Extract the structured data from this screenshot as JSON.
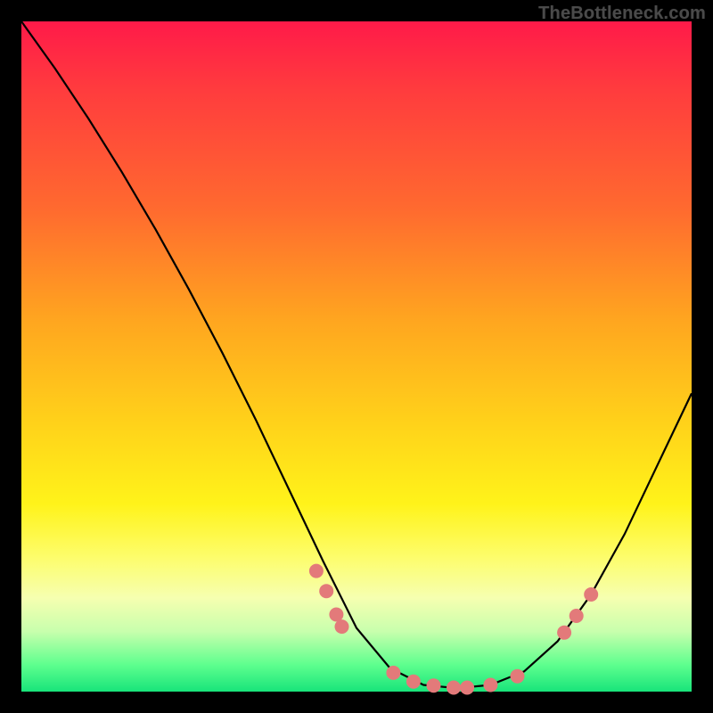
{
  "watermark": "TheBottleneck.com",
  "chart_data": {
    "type": "line",
    "title": "",
    "xlabel": "",
    "ylabel": "",
    "xlim": [
      0,
      1
    ],
    "ylim": [
      0,
      1
    ],
    "series": [
      {
        "name": "curve",
        "x": [
          0.0,
          0.05,
          0.1,
          0.15,
          0.2,
          0.25,
          0.3,
          0.35,
          0.4,
          0.45,
          0.5,
          0.55,
          0.6,
          0.65,
          0.7,
          0.75,
          0.8,
          0.85,
          0.9,
          0.95,
          1.0
        ],
        "y": [
          1.0,
          0.93,
          0.855,
          0.775,
          0.69,
          0.6,
          0.505,
          0.405,
          0.3,
          0.195,
          0.095,
          0.035,
          0.01,
          0.005,
          0.01,
          0.03,
          0.075,
          0.145,
          0.235,
          0.34,
          0.445
        ]
      }
    ],
    "markers": {
      "name": "dots",
      "color": "#e37a7a",
      "radius_px": 8,
      "points": [
        {
          "x": 0.44,
          "y": 0.18
        },
        {
          "x": 0.455,
          "y": 0.15
        },
        {
          "x": 0.47,
          "y": 0.115
        },
        {
          "x": 0.478,
          "y": 0.097
        },
        {
          "x": 0.555,
          "y": 0.028
        },
        {
          "x": 0.585,
          "y": 0.015
        },
        {
          "x": 0.615,
          "y": 0.009
        },
        {
          "x": 0.645,
          "y": 0.006
        },
        {
          "x": 0.665,
          "y": 0.006
        },
        {
          "x": 0.7,
          "y": 0.01
        },
        {
          "x": 0.74,
          "y": 0.023
        },
        {
          "x": 0.81,
          "y": 0.088
        },
        {
          "x": 0.828,
          "y": 0.113
        },
        {
          "x": 0.85,
          "y": 0.145
        }
      ]
    }
  }
}
